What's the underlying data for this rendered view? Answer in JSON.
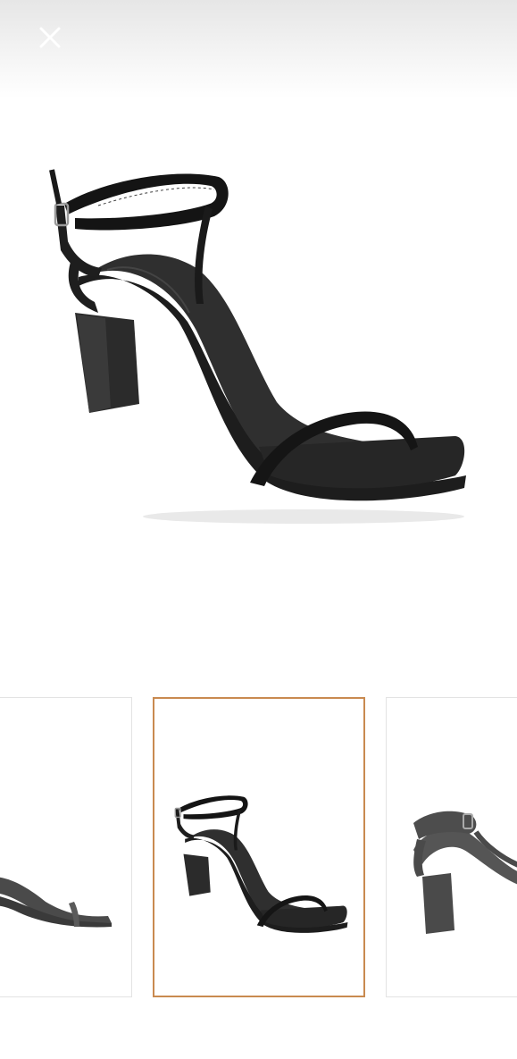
{
  "viewer": {
    "close_icon": "close-icon",
    "main_image": "black-strappy-block-heel-sandal",
    "selected_color": "#c98a50"
  },
  "thumbnails": [
    {
      "view": "side-cropped",
      "selected": false
    },
    {
      "view": "three-quarter-front",
      "selected": true
    },
    {
      "view": "back",
      "selected": false
    }
  ]
}
